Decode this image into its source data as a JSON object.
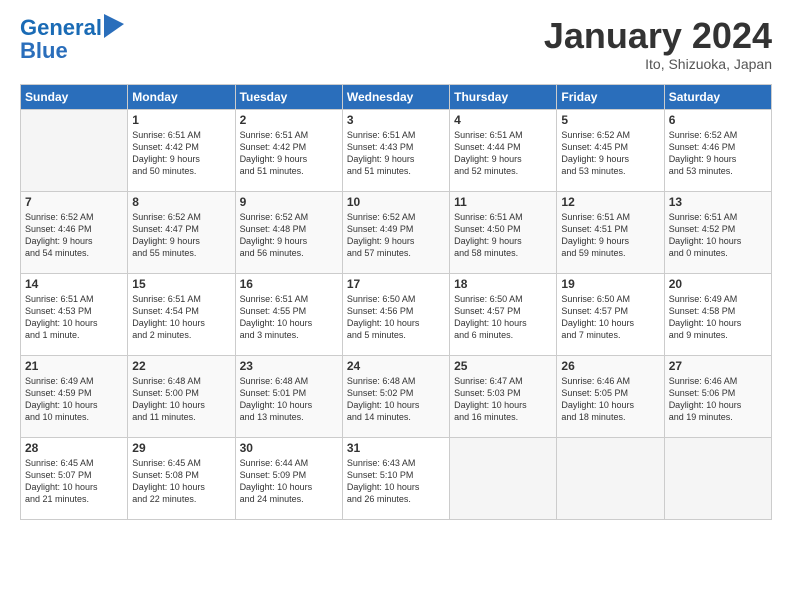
{
  "header": {
    "logo_line1": "General",
    "logo_line2": "Blue",
    "month": "January 2024",
    "location": "Ito, Shizuoka, Japan"
  },
  "weekdays": [
    "Sunday",
    "Monday",
    "Tuesday",
    "Wednesday",
    "Thursday",
    "Friday",
    "Saturday"
  ],
  "weeks": [
    [
      {
        "day": "",
        "info": ""
      },
      {
        "day": "1",
        "info": "Sunrise: 6:51 AM\nSunset: 4:42 PM\nDaylight: 9 hours\nand 50 minutes."
      },
      {
        "day": "2",
        "info": "Sunrise: 6:51 AM\nSunset: 4:42 PM\nDaylight: 9 hours\nand 51 minutes."
      },
      {
        "day": "3",
        "info": "Sunrise: 6:51 AM\nSunset: 4:43 PM\nDaylight: 9 hours\nand 51 minutes."
      },
      {
        "day": "4",
        "info": "Sunrise: 6:51 AM\nSunset: 4:44 PM\nDaylight: 9 hours\nand 52 minutes."
      },
      {
        "day": "5",
        "info": "Sunrise: 6:52 AM\nSunset: 4:45 PM\nDaylight: 9 hours\nand 53 minutes."
      },
      {
        "day": "6",
        "info": "Sunrise: 6:52 AM\nSunset: 4:46 PM\nDaylight: 9 hours\nand 53 minutes."
      }
    ],
    [
      {
        "day": "7",
        "info": "Sunrise: 6:52 AM\nSunset: 4:46 PM\nDaylight: 9 hours\nand 54 minutes."
      },
      {
        "day": "8",
        "info": "Sunrise: 6:52 AM\nSunset: 4:47 PM\nDaylight: 9 hours\nand 55 minutes."
      },
      {
        "day": "9",
        "info": "Sunrise: 6:52 AM\nSunset: 4:48 PM\nDaylight: 9 hours\nand 56 minutes."
      },
      {
        "day": "10",
        "info": "Sunrise: 6:52 AM\nSunset: 4:49 PM\nDaylight: 9 hours\nand 57 minutes."
      },
      {
        "day": "11",
        "info": "Sunrise: 6:51 AM\nSunset: 4:50 PM\nDaylight: 9 hours\nand 58 minutes."
      },
      {
        "day": "12",
        "info": "Sunrise: 6:51 AM\nSunset: 4:51 PM\nDaylight: 9 hours\nand 59 minutes."
      },
      {
        "day": "13",
        "info": "Sunrise: 6:51 AM\nSunset: 4:52 PM\nDaylight: 10 hours\nand 0 minutes."
      }
    ],
    [
      {
        "day": "14",
        "info": "Sunrise: 6:51 AM\nSunset: 4:53 PM\nDaylight: 10 hours\nand 1 minute."
      },
      {
        "day": "15",
        "info": "Sunrise: 6:51 AM\nSunset: 4:54 PM\nDaylight: 10 hours\nand 2 minutes."
      },
      {
        "day": "16",
        "info": "Sunrise: 6:51 AM\nSunset: 4:55 PM\nDaylight: 10 hours\nand 3 minutes."
      },
      {
        "day": "17",
        "info": "Sunrise: 6:50 AM\nSunset: 4:56 PM\nDaylight: 10 hours\nand 5 minutes."
      },
      {
        "day": "18",
        "info": "Sunrise: 6:50 AM\nSunset: 4:57 PM\nDaylight: 10 hours\nand 6 minutes."
      },
      {
        "day": "19",
        "info": "Sunrise: 6:50 AM\nSunset: 4:57 PM\nDaylight: 10 hours\nand 7 minutes."
      },
      {
        "day": "20",
        "info": "Sunrise: 6:49 AM\nSunset: 4:58 PM\nDaylight: 10 hours\nand 9 minutes."
      }
    ],
    [
      {
        "day": "21",
        "info": "Sunrise: 6:49 AM\nSunset: 4:59 PM\nDaylight: 10 hours\nand 10 minutes."
      },
      {
        "day": "22",
        "info": "Sunrise: 6:48 AM\nSunset: 5:00 PM\nDaylight: 10 hours\nand 11 minutes."
      },
      {
        "day": "23",
        "info": "Sunrise: 6:48 AM\nSunset: 5:01 PM\nDaylight: 10 hours\nand 13 minutes."
      },
      {
        "day": "24",
        "info": "Sunrise: 6:48 AM\nSunset: 5:02 PM\nDaylight: 10 hours\nand 14 minutes."
      },
      {
        "day": "25",
        "info": "Sunrise: 6:47 AM\nSunset: 5:03 PM\nDaylight: 10 hours\nand 16 minutes."
      },
      {
        "day": "26",
        "info": "Sunrise: 6:46 AM\nSunset: 5:05 PM\nDaylight: 10 hours\nand 18 minutes."
      },
      {
        "day": "27",
        "info": "Sunrise: 6:46 AM\nSunset: 5:06 PM\nDaylight: 10 hours\nand 19 minutes."
      }
    ],
    [
      {
        "day": "28",
        "info": "Sunrise: 6:45 AM\nSunset: 5:07 PM\nDaylight: 10 hours\nand 21 minutes."
      },
      {
        "day": "29",
        "info": "Sunrise: 6:45 AM\nSunset: 5:08 PM\nDaylight: 10 hours\nand 22 minutes."
      },
      {
        "day": "30",
        "info": "Sunrise: 6:44 AM\nSunset: 5:09 PM\nDaylight: 10 hours\nand 24 minutes."
      },
      {
        "day": "31",
        "info": "Sunrise: 6:43 AM\nSunset: 5:10 PM\nDaylight: 10 hours\nand 26 minutes."
      },
      {
        "day": "",
        "info": ""
      },
      {
        "day": "",
        "info": ""
      },
      {
        "day": "",
        "info": ""
      }
    ]
  ]
}
